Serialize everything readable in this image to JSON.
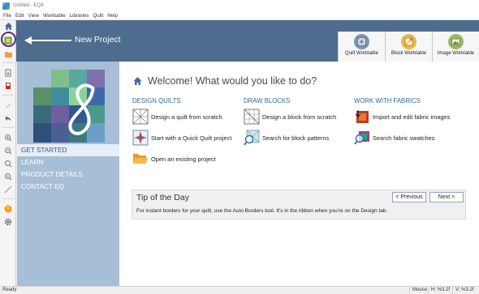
{
  "window": {
    "title": "Untitled - EQ8"
  },
  "menu": [
    "File",
    "Edit",
    "View",
    "Worktable",
    "Libraries",
    "Quilt",
    "Help"
  ],
  "ribbon": {
    "tabs": [
      {
        "label": "Quilt Worktable",
        "icon": "quilt-worktable-icon",
        "color": "#7f93b5"
      },
      {
        "label": "Block Worktable",
        "icon": "block-worktable-icon",
        "color": "#e6b84a"
      },
      {
        "label": "Image Worktable",
        "icon": "image-worktable-icon",
        "color": "#9bb865"
      }
    ]
  },
  "annotation": {
    "text": "New Project"
  },
  "sidebar": {
    "nav": [
      "GET STARTED",
      "LEARN",
      "PRODUCT DETAILS",
      "CONTACT EQ"
    ],
    "active_index": 0
  },
  "main": {
    "welcome": "Welcome! What would you like to do?",
    "columns": [
      {
        "heading": "DESIGN QUILTS",
        "items": [
          "Design a quilt from scratch",
          "Start with a Quick Quilt project",
          "Open an existing project"
        ]
      },
      {
        "heading": "DRAW BLOCKS",
        "items": [
          "Design a block from scratch",
          "Search for block patterns"
        ]
      },
      {
        "heading": "WORK WITH FABRICS",
        "items": [
          "Import and edit fabric images",
          "Search fabric swatches"
        ]
      }
    ],
    "tip": {
      "title": "Tip of the Day",
      "prev": "< Previous",
      "next": "Next >",
      "text": "For instant borders for your quilt, use the Auto Borders tool. It's in the ribbon when you're on the Design tab."
    }
  },
  "status": {
    "ready": "Ready",
    "mouse": "Mouse",
    "h": "H: %3.2f",
    "v": "V: %3.2f"
  },
  "colors": {
    "ribbon": "#4e6c8e",
    "sidebar": "#a6bfd6",
    "heading": "#2e6aa2",
    "highlight": "#5a2a82"
  }
}
